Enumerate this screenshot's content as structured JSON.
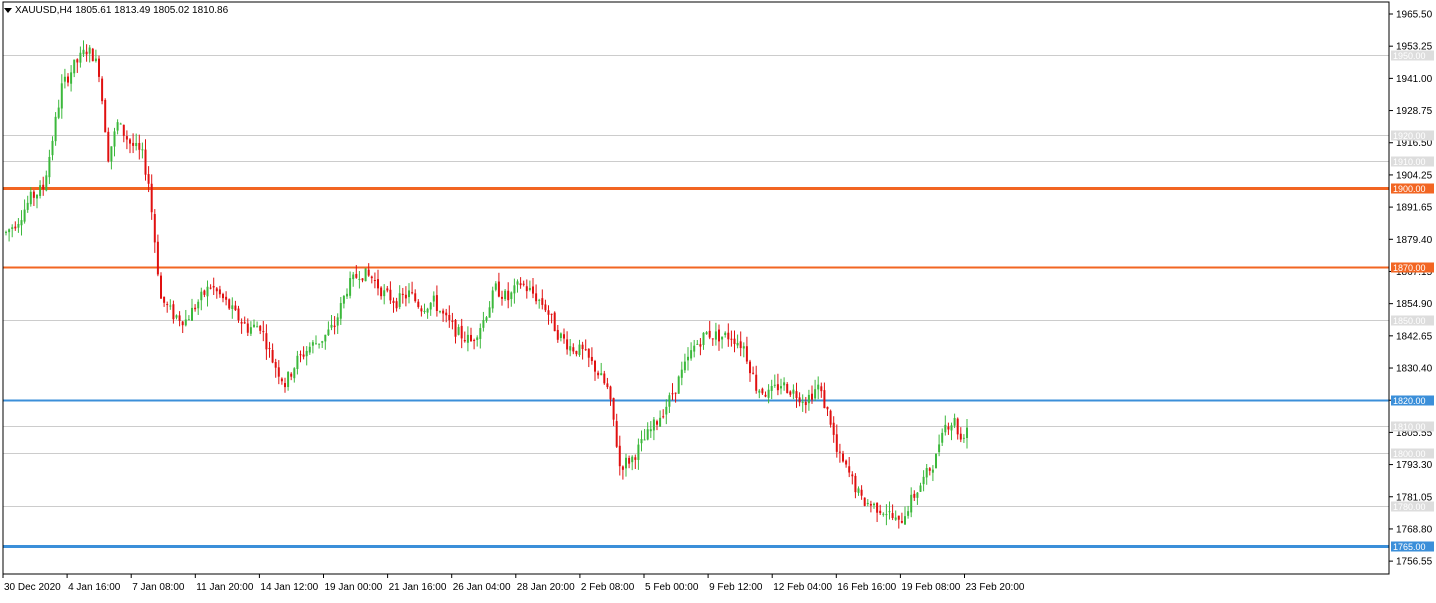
{
  "header": {
    "symbol": "XAUUSD,H4",
    "ohlc": "1805.61 1813.49 1805.02 1810.86"
  },
  "price_axis": {
    "ticks": [
      "1965.50",
      "1953.25",
      "1941.00",
      "1928.75",
      "1916.50",
      "1904.25",
      "1891.65",
      "1879.40",
      "1867.15",
      "1854.90",
      "1842.65",
      "1830.40",
      "1817.80",
      "1805.55",
      "1793.30",
      "1781.05",
      "1768.80",
      "1756.55"
    ]
  },
  "time_axis": {
    "ticks": [
      "30 Dec 2020",
      "4 Jan 16:00",
      "7 Jan 08:00",
      "11 Jan 20:00",
      "14 Jan 12:00",
      "19 Jan 00:00",
      "21 Jan 16:00",
      "26 Jan 04:00",
      "28 Jan 20:00",
      "2 Feb 08:00",
      "5 Feb 00:00",
      "9 Feb 12:00",
      "12 Feb 04:00",
      "16 Feb 16:00",
      "19 Feb 08:00",
      "23 Feb 20:00"
    ]
  },
  "levels": [
    {
      "label": "1950.00",
      "price": 1950,
      "color": "#cccccc",
      "style": "thin"
    },
    {
      "label": "1920.00",
      "price": 1920,
      "color": "#cccccc",
      "style": "thin"
    },
    {
      "label": "1910.00",
      "price": 1910,
      "color": "#cccccc",
      "style": "thin"
    },
    {
      "label": "1900.00",
      "price": 1900,
      "color": "#f26522",
      "style": "thick"
    },
    {
      "label": "1870.00",
      "price": 1870,
      "color": "#f26522",
      "style": "medium"
    },
    {
      "label": "1850.00",
      "price": 1850,
      "color": "#cccccc",
      "style": "thin"
    },
    {
      "label": "1820.00",
      "price": 1820,
      "color": "#3b8fd9",
      "style": "medium"
    },
    {
      "label": "1810.00",
      "price": 1810,
      "color": "#cccccc",
      "style": "thin"
    },
    {
      "label": "1800.00",
      "price": 1800,
      "color": "#cccccc",
      "style": "thin"
    },
    {
      "label": "1780.00",
      "price": 1780,
      "color": "#cccccc",
      "style": "thin"
    },
    {
      "label": "1765.00",
      "price": 1765,
      "color": "#3b8fd9",
      "style": "thick"
    }
  ],
  "colors": {
    "bull": "#3cb83c",
    "bear": "#e01010",
    "grid": "#cccccc",
    "axis": "#000000"
  },
  "chart_data": {
    "type": "candlestick",
    "symbol": "XAUUSD",
    "timeframe": "H4",
    "ylim": [
      1754.3,
      1970.0
    ],
    "x_categories": [
      "30 Dec 2020",
      "4 Jan 16:00",
      "7 Jan 08:00",
      "11 Jan 20:00",
      "14 Jan 12:00",
      "19 Jan 00:00",
      "21 Jan 16:00",
      "26 Jan 04:00",
      "28 Jan 20:00",
      "2 Feb 08:00",
      "5 Feb 00:00",
      "9 Feb 12:00",
      "12 Feb 04:00",
      "16 Feb 16:00",
      "19 Feb 08:00",
      "23 Feb 20:00"
    ],
    "close_path": [
      [
        0,
        1883
      ],
      [
        4,
        1888
      ],
      [
        8,
        1896
      ],
      [
        12,
        1900
      ],
      [
        14,
        1912
      ],
      [
        18,
        1938
      ],
      [
        22,
        1946
      ],
      [
        26,
        1952
      ],
      [
        28,
        1950
      ],
      [
        30,
        1944
      ],
      [
        33,
        1912
      ],
      [
        36,
        1924
      ],
      [
        40,
        1917
      ],
      [
        44,
        1912
      ],
      [
        46,
        1902
      ],
      [
        48,
        1880
      ],
      [
        50,
        1858
      ],
      [
        54,
        1852
      ],
      [
        58,
        1850
      ],
      [
        62,
        1857
      ],
      [
        66,
        1863
      ],
      [
        70,
        1858
      ],
      [
        74,
        1852
      ],
      [
        78,
        1847
      ],
      [
        82,
        1848
      ],
      [
        86,
        1835
      ],
      [
        90,
        1826
      ],
      [
        94,
        1835
      ],
      [
        98,
        1840
      ],
      [
        102,
        1843
      ],
      [
        106,
        1848
      ],
      [
        110,
        1862
      ],
      [
        114,
        1868
      ],
      [
        118,
        1866
      ],
      [
        122,
        1860
      ],
      [
        126,
        1857
      ],
      [
        130,
        1860
      ],
      [
        134,
        1855
      ],
      [
        138,
        1857
      ],
      [
        142,
        1850
      ],
      [
        146,
        1845
      ],
      [
        150,
        1842
      ],
      [
        154,
        1850
      ],
      [
        158,
        1862
      ],
      [
        162,
        1858
      ],
      [
        166,
        1864
      ],
      [
        170,
        1860
      ],
      [
        174,
        1855
      ],
      [
        178,
        1845
      ],
      [
        182,
        1840
      ],
      [
        186,
        1838
      ],
      [
        190,
        1832
      ],
      [
        194,
        1824
      ],
      [
        196,
        1812
      ],
      [
        198,
        1795
      ],
      [
        202,
        1798
      ],
      [
        206,
        1805
      ],
      [
        210,
        1812
      ],
      [
        214,
        1820
      ],
      [
        218,
        1830
      ],
      [
        222,
        1840
      ],
      [
        226,
        1845
      ],
      [
        230,
        1844
      ],
      [
        234,
        1844
      ],
      [
        238,
        1840
      ],
      [
        242,
        1825
      ],
      [
        246,
        1822
      ],
      [
        250,
        1826
      ],
      [
        254,
        1823
      ],
      [
        258,
        1820
      ],
      [
        262,
        1825
      ],
      [
        266,
        1812
      ],
      [
        268,
        1800
      ],
      [
        272,
        1792
      ],
      [
        276,
        1782
      ],
      [
        280,
        1780
      ],
      [
        284,
        1778
      ],
      [
        288,
        1773
      ],
      [
        292,
        1782
      ],
      [
        296,
        1790
      ],
      [
        300,
        1798
      ],
      [
        302,
        1810
      ],
      [
        306,
        1812
      ],
      [
        308,
        1805
      ],
      [
        310,
        1810
      ]
    ],
    "title": "",
    "xlabel": "",
    "ylabel": "",
    "grid": false
  }
}
